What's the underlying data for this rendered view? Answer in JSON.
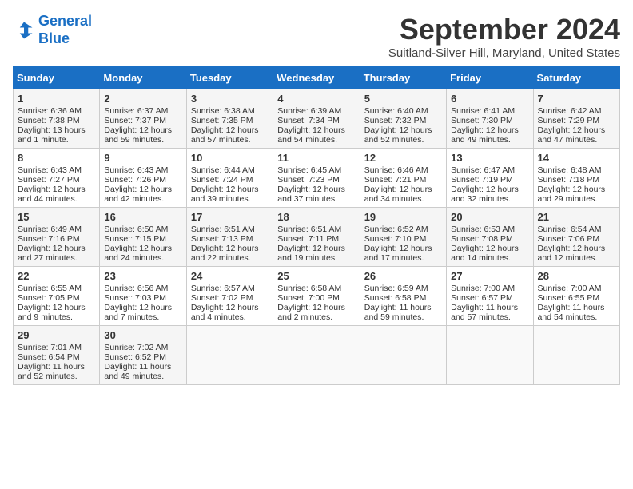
{
  "header": {
    "logo_line1": "General",
    "logo_line2": "Blue",
    "month_title": "September 2024",
    "subtitle": "Suitland-Silver Hill, Maryland, United States"
  },
  "days_of_week": [
    "Sunday",
    "Monday",
    "Tuesday",
    "Wednesday",
    "Thursday",
    "Friday",
    "Saturday"
  ],
  "weeks": [
    [
      {
        "day": "1",
        "info": "Sunrise: 6:36 AM\nSunset: 7:38 PM\nDaylight: 13 hours\nand 1 minute."
      },
      {
        "day": "2",
        "info": "Sunrise: 6:37 AM\nSunset: 7:37 PM\nDaylight: 12 hours\nand 59 minutes."
      },
      {
        "day": "3",
        "info": "Sunrise: 6:38 AM\nSunset: 7:35 PM\nDaylight: 12 hours\nand 57 minutes."
      },
      {
        "day": "4",
        "info": "Sunrise: 6:39 AM\nSunset: 7:34 PM\nDaylight: 12 hours\nand 54 minutes."
      },
      {
        "day": "5",
        "info": "Sunrise: 6:40 AM\nSunset: 7:32 PM\nDaylight: 12 hours\nand 52 minutes."
      },
      {
        "day": "6",
        "info": "Sunrise: 6:41 AM\nSunset: 7:30 PM\nDaylight: 12 hours\nand 49 minutes."
      },
      {
        "day": "7",
        "info": "Sunrise: 6:42 AM\nSunset: 7:29 PM\nDaylight: 12 hours\nand 47 minutes."
      }
    ],
    [
      {
        "day": "8",
        "info": "Sunrise: 6:43 AM\nSunset: 7:27 PM\nDaylight: 12 hours\nand 44 minutes."
      },
      {
        "day": "9",
        "info": "Sunrise: 6:43 AM\nSunset: 7:26 PM\nDaylight: 12 hours\nand 42 minutes."
      },
      {
        "day": "10",
        "info": "Sunrise: 6:44 AM\nSunset: 7:24 PM\nDaylight: 12 hours\nand 39 minutes."
      },
      {
        "day": "11",
        "info": "Sunrise: 6:45 AM\nSunset: 7:23 PM\nDaylight: 12 hours\nand 37 minutes."
      },
      {
        "day": "12",
        "info": "Sunrise: 6:46 AM\nSunset: 7:21 PM\nDaylight: 12 hours\nand 34 minutes."
      },
      {
        "day": "13",
        "info": "Sunrise: 6:47 AM\nSunset: 7:19 PM\nDaylight: 12 hours\nand 32 minutes."
      },
      {
        "day": "14",
        "info": "Sunrise: 6:48 AM\nSunset: 7:18 PM\nDaylight: 12 hours\nand 29 minutes."
      }
    ],
    [
      {
        "day": "15",
        "info": "Sunrise: 6:49 AM\nSunset: 7:16 PM\nDaylight: 12 hours\nand 27 minutes."
      },
      {
        "day": "16",
        "info": "Sunrise: 6:50 AM\nSunset: 7:15 PM\nDaylight: 12 hours\nand 24 minutes."
      },
      {
        "day": "17",
        "info": "Sunrise: 6:51 AM\nSunset: 7:13 PM\nDaylight: 12 hours\nand 22 minutes."
      },
      {
        "day": "18",
        "info": "Sunrise: 6:51 AM\nSunset: 7:11 PM\nDaylight: 12 hours\nand 19 minutes."
      },
      {
        "day": "19",
        "info": "Sunrise: 6:52 AM\nSunset: 7:10 PM\nDaylight: 12 hours\nand 17 minutes."
      },
      {
        "day": "20",
        "info": "Sunrise: 6:53 AM\nSunset: 7:08 PM\nDaylight: 12 hours\nand 14 minutes."
      },
      {
        "day": "21",
        "info": "Sunrise: 6:54 AM\nSunset: 7:06 PM\nDaylight: 12 hours\nand 12 minutes."
      }
    ],
    [
      {
        "day": "22",
        "info": "Sunrise: 6:55 AM\nSunset: 7:05 PM\nDaylight: 12 hours\nand 9 minutes."
      },
      {
        "day": "23",
        "info": "Sunrise: 6:56 AM\nSunset: 7:03 PM\nDaylight: 12 hours\nand 7 minutes."
      },
      {
        "day": "24",
        "info": "Sunrise: 6:57 AM\nSunset: 7:02 PM\nDaylight: 12 hours\nand 4 minutes."
      },
      {
        "day": "25",
        "info": "Sunrise: 6:58 AM\nSunset: 7:00 PM\nDaylight: 12 hours\nand 2 minutes."
      },
      {
        "day": "26",
        "info": "Sunrise: 6:59 AM\nSunset: 6:58 PM\nDaylight: 11 hours\nand 59 minutes."
      },
      {
        "day": "27",
        "info": "Sunrise: 7:00 AM\nSunset: 6:57 PM\nDaylight: 11 hours\nand 57 minutes."
      },
      {
        "day": "28",
        "info": "Sunrise: 7:00 AM\nSunset: 6:55 PM\nDaylight: 11 hours\nand 54 minutes."
      }
    ],
    [
      {
        "day": "29",
        "info": "Sunrise: 7:01 AM\nSunset: 6:54 PM\nDaylight: 11 hours\nand 52 minutes."
      },
      {
        "day": "30",
        "info": "Sunrise: 7:02 AM\nSunset: 6:52 PM\nDaylight: 11 hours\nand 49 minutes."
      },
      {
        "day": "",
        "info": ""
      },
      {
        "day": "",
        "info": ""
      },
      {
        "day": "",
        "info": ""
      },
      {
        "day": "",
        "info": ""
      },
      {
        "day": "",
        "info": ""
      }
    ]
  ]
}
